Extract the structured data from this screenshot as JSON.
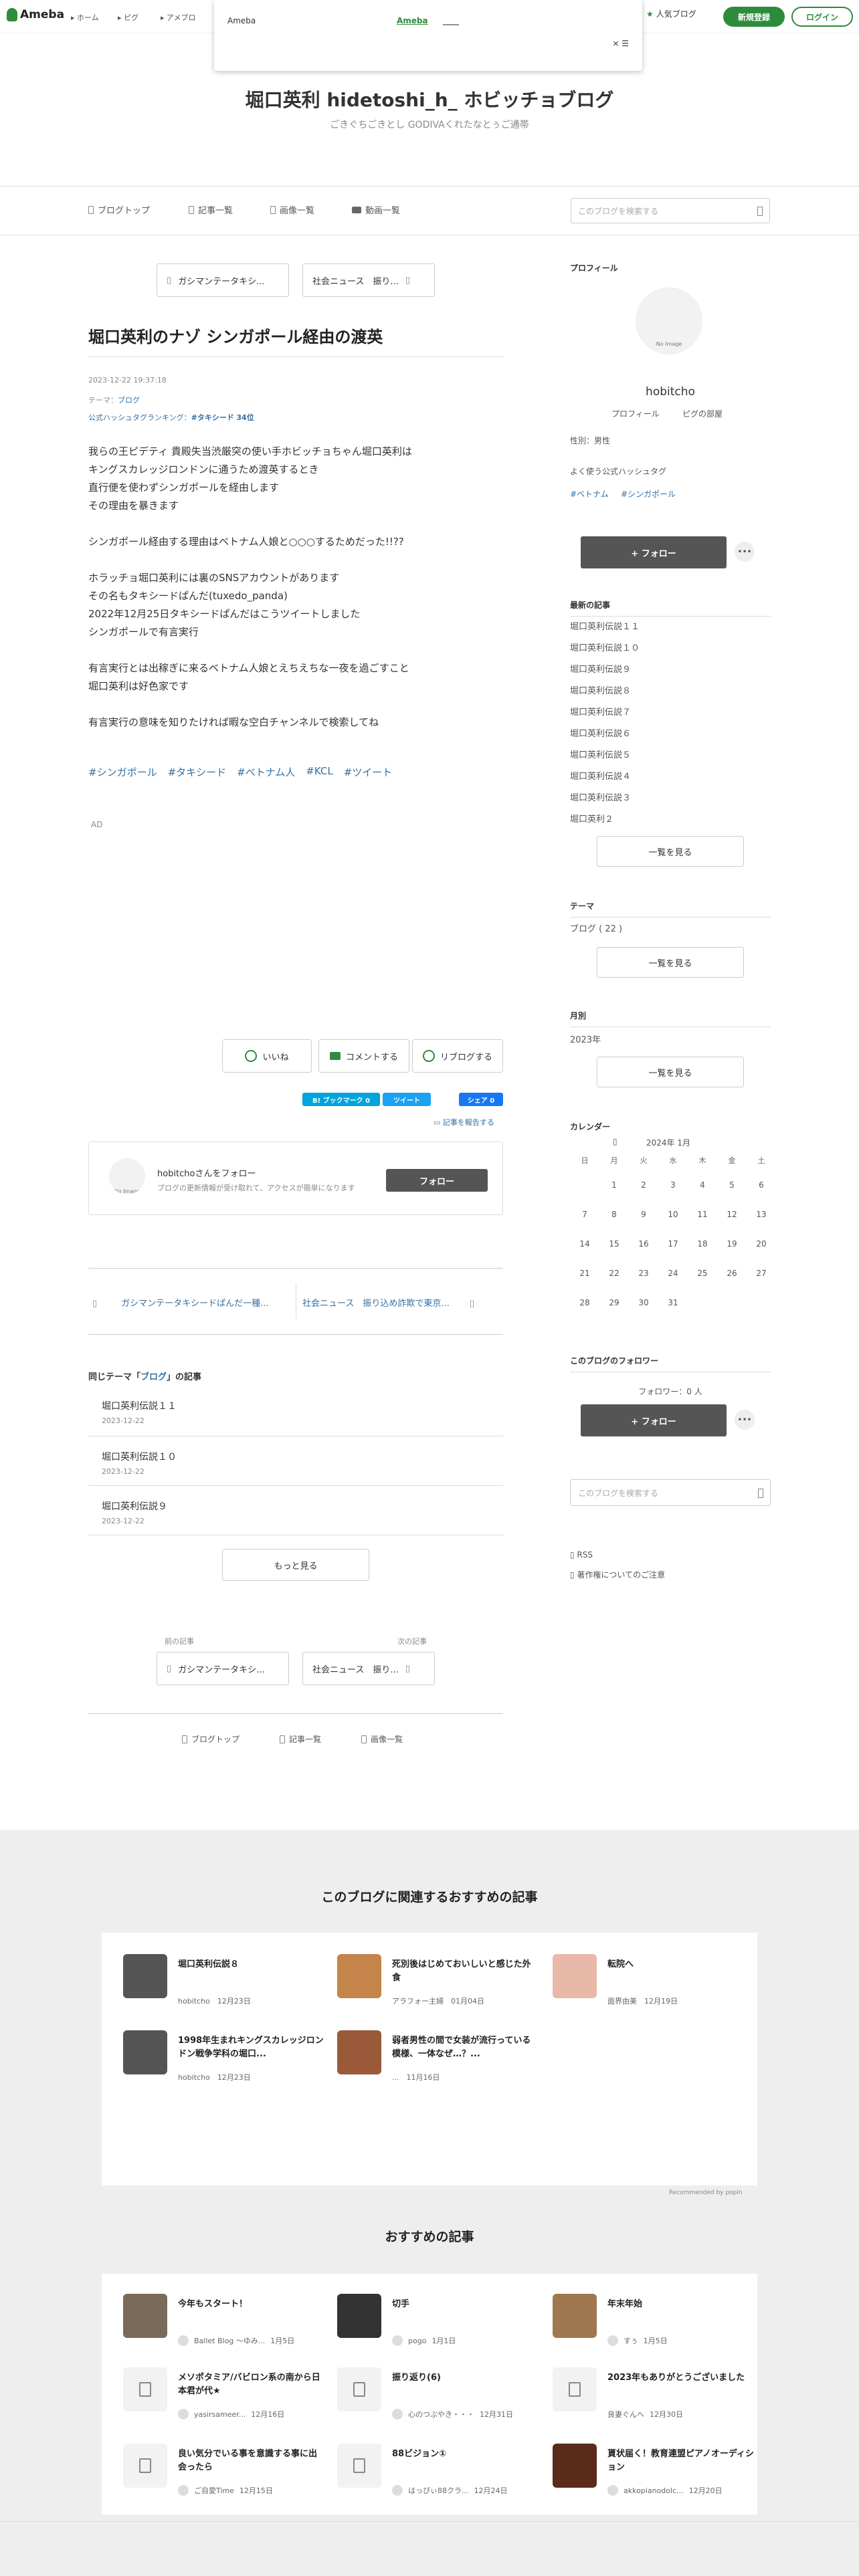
{
  "header": {
    "logo": "Ameba",
    "nav": [
      "ホーム",
      "ピグ",
      "アメブロ"
    ],
    "popup": {
      "title": "Ameba",
      "link": "Ameba",
      "link2": "____",
      "close": "× ☰"
    },
    "popular_blog": "人気ブログ",
    "register": "新規登録",
    "login": "ログイン"
  },
  "blog": {
    "title": "堀口英利 hidetoshi_h_ ホビッチョブログ",
    "description": "ごきぐちごきとし GODIVAくれたなとぅご通帯",
    "nav": [
      "ブログトップ",
      "記事一覧",
      "画像一覧",
      "動画一覧"
    ],
    "search_placeholder": "このブログを検索する"
  },
  "article": {
    "prev_top": "ガシマンテータキシ...",
    "next_top": "社会ニュース　振り...",
    "title": "堀口英利のナゾ シンガポール経由の渡英",
    "date": "2023-12-22 19:37:18",
    "theme_label": "テーマ：",
    "theme": "ブログ",
    "ranking_label": "公式ハッシュタグランキング：",
    "ranking_tag": "#タキシード",
    "ranking_pos": "34位",
    "body": [
      "我らの王ピデティ 貴殿失当渋厳突の使い手ホビッチョちゃん堀口英利は",
      "キングスカレッジロンドンに通うため渡英するとき",
      "直行便を使わずシンガポールを経由します",
      "その理由を暴きます",
      "",
      "シンガポール経由する理由はベトナム人娘と○○○するためだった!!??",
      "",
      "ホラッチョ堀口英利には裏のSNSアカウントがあります",
      "その名もタキシードぱんだ(tuxedo_panda)",
      "2022年12月25日タキシードぱんだはこうツイートしました",
      "シンガポールで有言実行",
      "",
      "有言実行とは出稼ぎに来るベトナム人娘とえちえちな一夜を過ごすこと",
      "堀口英利は好色家です",
      "",
      "有言実行の意味を知りたければ暇な空白チャンネルで検索してね"
    ],
    "tags": [
      "#シンガポール",
      "#タキシード",
      "#ベトナム人",
      "#KCL",
      "#ツイート"
    ],
    "ad": "AD",
    "like": "いいね",
    "comment": "コメントする",
    "reblog": "リブログする",
    "hatena": "B! ブックマーク 0",
    "tweet": "ツイート",
    "fb": "シェア 0",
    "report": "記事を報告する",
    "follow_title": "hobitchoさんをフォロー",
    "follow_desc": "ブログの更新情報が受け取れて、アクセスが簡単になります",
    "follow_btn": "フォロー",
    "no_image": "No Image",
    "prev_bottom": "ガシマンテータキシードぱんだ一種...",
    "next_bottom": "社会ニュース　振り込め詐欺で東京...",
    "same_theme_pre": "同じテーマ「",
    "same_theme_name": "ブログ",
    "same_theme_post": "」の記事",
    "same_theme": [
      {
        "title": "堀口英利伝説１１",
        "date": "2023-12-22"
      },
      {
        "title": "堀口英利伝説１０",
        "date": "2023-12-22"
      },
      {
        "title": "堀口英利伝説９",
        "date": "2023-12-22"
      }
    ],
    "more": "もっと見る",
    "prev_label": "前の記事",
    "next_label": "次の記事",
    "prev2": "ガシマンテータキシ...",
    "next2": "社会ニュース　振り...",
    "footer_nav": [
      "ブログトップ",
      "記事一覧",
      "画像一覧"
    ]
  },
  "sidebar": {
    "profile_head": "プロフィール",
    "name": "hobitcho",
    "no_image": "No Image",
    "profile_link": "プロフィール",
    "pigu_link": "ピグの部屋",
    "gender": "性別：男性",
    "hashtag_head": "よく使う公式ハッシュタグ",
    "hashtags": [
      "#ベトナム",
      "#シンガポール"
    ],
    "follow": "+ フォロー",
    "dots": "•••",
    "recent_head": "最新の記事",
    "recent": [
      "堀口英利伝説１１",
      "堀口英利伝説１０",
      "堀口英利伝説９",
      "堀口英利伝説８",
      "堀口英利伝説７",
      "堀口英利伝説６",
      "堀口英利伝説５",
      "堀口英利伝説４",
      "堀口英利伝説３",
      "堀口英利２"
    ],
    "list_btn": "一覧を見る",
    "theme_head": "テーマ",
    "theme_item": "ブログ ( 22 )",
    "month_head": "月別",
    "month_item": "2023年",
    "calendar_head": "カレンダー",
    "calendar_title": "2024年 1月",
    "weekdays": [
      "日",
      "月",
      "火",
      "水",
      "木",
      "金",
      "土"
    ],
    "weeks": [
      [
        "",
        "1",
        "2",
        "3",
        "4",
        "5",
        "6"
      ],
      [
        "7",
        "8",
        "9",
        "10",
        "11",
        "12",
        "13"
      ],
      [
        "14",
        "15",
        "16",
        "17",
        "18",
        "19",
        "20"
      ],
      [
        "21",
        "22",
        "23",
        "24",
        "25",
        "26",
        "27"
      ],
      [
        "28",
        "29",
        "30",
        "31",
        "",
        "",
        ""
      ]
    ],
    "followers_head": "このブログのフォロワー",
    "followers": "フォロワー：0 人",
    "search_placeholder": "このブログを検索する",
    "rss": "RSS",
    "copyright": "著作権についてのご注意"
  },
  "recommend": {
    "head": "このブログに関連するおすすめの記事",
    "items": [
      {
        "title": "堀口英利伝説８",
        "author": "hobitcho",
        "date": "12月23日"
      },
      {
        "title": "死別後はじめておいしいと感じた外食",
        "author": "アラフォー主婦",
        "date": "01月04日"
      },
      {
        "title": "転院へ",
        "author": "面界由美",
        "date": "12月19日"
      },
      {
        "title": "1998年生まれキングスカレッジロンドン戦争学科の堀口...",
        "author": "hobitcho",
        "date": "12月23日"
      },
      {
        "title": "弱者男性の間で女装が流行っている模様、一体なぜ…？...",
        "author": "...",
        "date": "11月16日"
      }
    ],
    "recommended_by": "Recommended by popIn",
    "head2": "おすすめの記事",
    "items2": [
      {
        "title": "今年もスタート！",
        "author": "Ballet Blog ～ゆみ...",
        "date": "1月5日"
      },
      {
        "title": "切手",
        "author": "pogo",
        "date": "1月1日"
      },
      {
        "title": "年末年始",
        "author": "すぅ",
        "date": "1月5日"
      },
      {
        "title": "メソポタミア/バビロン系の南から日本君が代★",
        "author": "yasirsameer...",
        "date": "12月16日"
      },
      {
        "title": "振り返り(6)",
        "author": "心のつぶやき・・・",
        "date": "12月31日"
      },
      {
        "title": "2023年もありがとうございました",
        "author": "良妻ぐんへ",
        "date": "12月30日"
      },
      {
        "title": "良い気分でいる事を意識する事に出会ったら",
        "author": "ご自愛Time",
        "date": "12月15日"
      },
      {
        "title": "88ビジョン①",
        "author": "はっぴぃ88クラ...",
        "date": "12月24日"
      },
      {
        "title": "貰状届く！教育連盟ピアノオーディション",
        "author": "akkopianodolc...",
        "date": "12月20日"
      }
    ]
  }
}
